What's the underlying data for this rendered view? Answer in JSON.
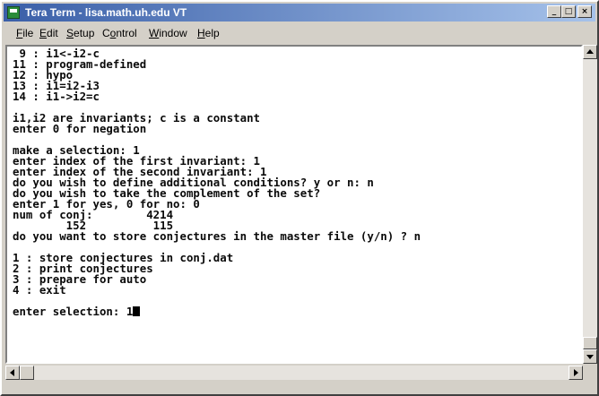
{
  "window": {
    "title": "Tera Term - lisa.math.uh.edu VT",
    "buttons": {
      "minimize": "_",
      "maximize": "□",
      "close": "×"
    }
  },
  "menu": {
    "file": {
      "mnemonic": "F",
      "rest": "ile"
    },
    "edit": {
      "mnemonic": "E",
      "rest": "dit"
    },
    "setup": {
      "mnemonic": "S",
      "rest": "etup"
    },
    "control": {
      "mnemonic": "o",
      "pre": "C",
      "rest": "ntrol"
    },
    "window": {
      "mnemonic": "W",
      "rest": "indow"
    },
    "help": {
      "mnemonic": "H",
      "rest": "elp"
    }
  },
  "terminal": {
    "lines": [
      " 9 : i1<-i2-c",
      "11 : program-defined",
      "12 : hypo",
      "13 : i1=i2-i3",
      "14 : i1->i2=c",
      "",
      "i1,i2 are invariants; c is a constant",
      "enter 0 for negation",
      "",
      "make a selection: 1",
      "enter index of the first invariant: 1",
      "enter index of the second invariant: 1",
      "do you wish to define additional conditions? y or n: n",
      "do you wish to take the complement of the set?",
      "enter 1 for yes, 0 for no: 0",
      "num of conj:        4214",
      "        152          115",
      "do you want to store conjectures in the master file (y/n) ? n",
      "",
      "1 : store conjectures in conj.dat",
      "2 : print conjectures",
      "3 : prepare for auto",
      "4 : exit",
      "",
      "enter selection: 1"
    ]
  }
}
